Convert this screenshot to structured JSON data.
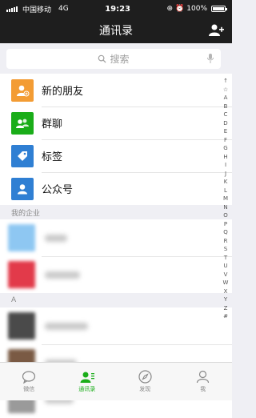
{
  "status_bar": {
    "carrier": "中国移动",
    "network": "4G",
    "time": "19:23",
    "battery": "100%"
  },
  "nav": {
    "title": "通讯录"
  },
  "search": {
    "placeholder": "搜索"
  },
  "functions": [
    {
      "label": "新的朋友",
      "icon": "add-friend-icon",
      "color": "#f39c34"
    },
    {
      "label": "群聊",
      "icon": "group-chat-icon",
      "color": "#1aad19"
    },
    {
      "label": "标签",
      "icon": "tag-icon",
      "color": "#2f7fd3"
    },
    {
      "label": "公众号",
      "icon": "official-account-icon",
      "color": "#2f7fd3"
    }
  ],
  "sections": {
    "enterprise": "我的企业",
    "a": "A"
  },
  "index_letters": [
    "↑",
    "☆",
    "A",
    "B",
    "C",
    "D",
    "E",
    "F",
    "G",
    "H",
    "I",
    "J",
    "K",
    "L",
    "M",
    "N",
    "O",
    "P",
    "Q",
    "R",
    "S",
    "T",
    "U",
    "V",
    "W",
    "X",
    "Y",
    "Z",
    "#"
  ],
  "tabs": [
    {
      "label": "微信",
      "icon": "chat-bubble-icon",
      "active": false
    },
    {
      "label": "通讯录",
      "icon": "contacts-icon",
      "active": true
    },
    {
      "label": "发现",
      "icon": "compass-icon",
      "active": false
    },
    {
      "label": "我",
      "icon": "profile-icon",
      "active": false
    }
  ],
  "colors": {
    "accent": "#1aad19",
    "header_bg": "#1e1e1e"
  }
}
